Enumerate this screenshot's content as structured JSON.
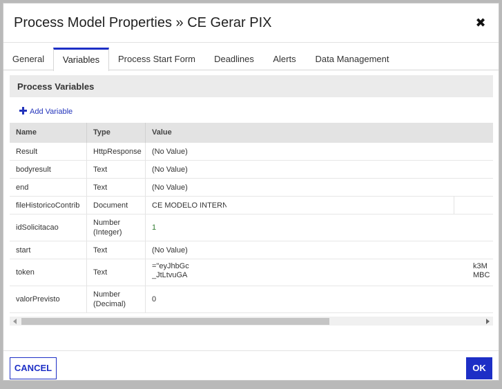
{
  "dialog": {
    "title": "Process Model Properties » CE Gerar PIX",
    "close_glyph": "✖"
  },
  "tabs": [
    {
      "label": "General"
    },
    {
      "label": "Variables"
    },
    {
      "label": "Process Start Form"
    },
    {
      "label": "Deadlines"
    },
    {
      "label": "Alerts"
    },
    {
      "label": "Data Management"
    }
  ],
  "active_tab": "Variables",
  "panel": {
    "title": "Process Variables",
    "add_label": "Add Variable"
  },
  "table": {
    "columns": [
      "Name",
      "Type",
      "Value"
    ],
    "rows": [
      {
        "name": "Result",
        "type": "HttpResponse",
        "value": "(No Value)"
      },
      {
        "name": "bodyresult",
        "type": "Text",
        "value": "(No Value)"
      },
      {
        "name": "end",
        "type": "Text",
        "value": "(No Value)"
      },
      {
        "name": "fileHistoricoContrib",
        "type": "Document",
        "value": "CE MODELO INTERNO"
      },
      {
        "name": "idSolicitacao",
        "type": "Number (Integer)",
        "value": "1"
      },
      {
        "name": "start",
        "type": "Text",
        "value": "(No Value)"
      },
      {
        "name": "token",
        "type": "Text",
        "value": "=\"eyJhbGc",
        "value_line2": "_JtLtvuGA",
        "value_tail1": "k3M",
        "value_tail2": "MBC"
      },
      {
        "name": "valorPrevisto",
        "type": "Number (Decimal)",
        "value": "0"
      }
    ]
  },
  "footer": {
    "cancel_label": "CANCEL",
    "ok_label": "OK"
  },
  "colors": {
    "accent": "#1d2fc6",
    "header_bg": "#e3e3e3",
    "panel_bg": "#ebebeb"
  }
}
